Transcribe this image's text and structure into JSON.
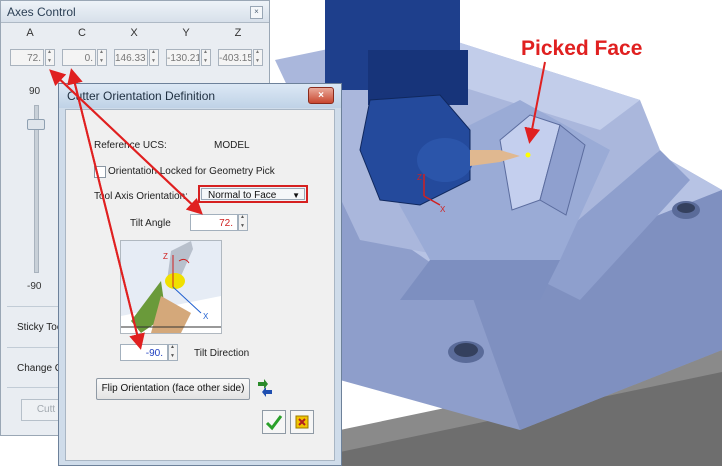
{
  "axes_control": {
    "title": "Axes Control",
    "axes": [
      {
        "name": "A",
        "value": "72."
      },
      {
        "name": "C",
        "value": "0."
      },
      {
        "name": "X",
        "value": "146.33"
      },
      {
        "name": "Y",
        "value": "-130.21"
      },
      {
        "name": "Z",
        "value": "-403.15"
      }
    ],
    "slider_max": "90",
    "slider_min": "-90",
    "sticky_label": "Sticky Too",
    "change_label": "Change C",
    "cutter_button": "Cutt"
  },
  "dialog": {
    "title": "Cutter Orientation Definition",
    "reference_label": "Reference UCS:",
    "reference_value": "MODEL",
    "orientation_locked_label": "Orientation Locked for Geometry Pick",
    "tool_axis_label": "Tool Axis Orientation:",
    "tool_axis_value": "Normal to Face",
    "tilt_angle_label": "Tilt Angle",
    "tilt_angle_value": "72.",
    "tilt_direction_label": "Tilt Direction",
    "tilt_direction_value": "-90.",
    "diagram_labels": {
      "z": "Z",
      "x": "X"
    },
    "flip_button": "Flip Orientation (face other side)"
  },
  "viewport": {
    "picked_face_label": "Picked Face",
    "triad_labels": {
      "z": "Z",
      "x": "X",
      "y": "Y"
    }
  },
  "colors": {
    "annotation_red": "#e02020",
    "tool_head_blue": "#1e3f8c",
    "part_blue": "#a7b5d9",
    "dialog_border": "#6d819a"
  },
  "icons": [
    "checkmark-icon",
    "cancel-icon",
    "flip-arrows-icon",
    "close-icon"
  ]
}
